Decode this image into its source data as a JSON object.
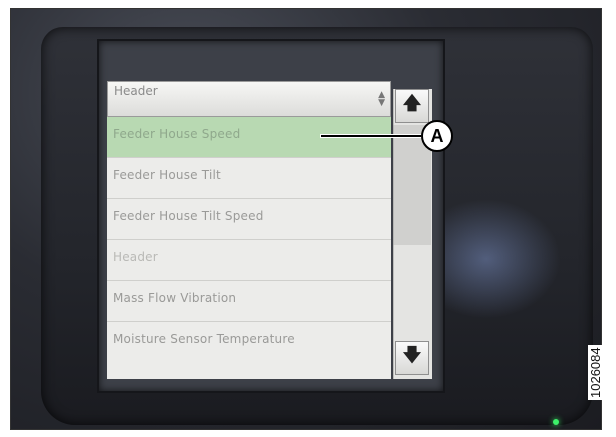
{
  "dropdown": {
    "selected": "Header"
  },
  "list_items": [
    {
      "label": "Feeder House Speed",
      "selected": true,
      "group": false
    },
    {
      "label": "Feeder House Tilt",
      "selected": false,
      "group": false
    },
    {
      "label": "Feeder House Tilt Speed",
      "selected": false,
      "group": false
    },
    {
      "label": "Header",
      "selected": false,
      "group": true
    },
    {
      "label": "Mass Flow Vibration",
      "selected": false,
      "group": false
    },
    {
      "label": "Moisture Sensor Temperature",
      "selected": false,
      "group": false
    }
  ],
  "scroll": {
    "up_icon": "up-arrow-icon",
    "down_icon": "down-arrow-icon",
    "up_glyph": "🡅",
    "down_glyph": "🡇"
  },
  "callout": {
    "label": "A"
  },
  "figure_id": "1026084"
}
